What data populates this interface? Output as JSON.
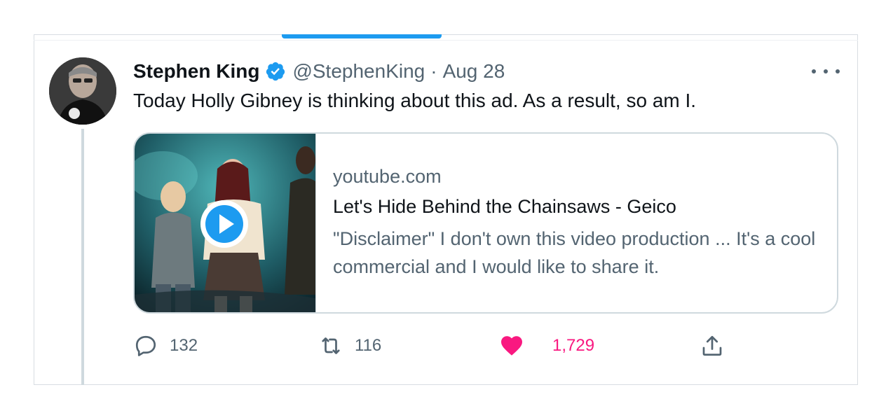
{
  "tweet": {
    "author_name": "Stephen King",
    "handle": "@StephenKing",
    "separator": "·",
    "date": "Aug 28",
    "text": "Today Holly Gibney is thinking about this ad. As a result, so am I."
  },
  "card": {
    "domain": "youtube.com",
    "title": "Let's Hide Behind the Chainsaws - Geico",
    "description": "\"Disclaimer\" I don't own this video production ... It's a cool commercial and I would like to share it."
  },
  "actions": {
    "replies": "132",
    "retweets": "116",
    "likes": "1,729"
  },
  "colors": {
    "accent": "#1d9bf0",
    "like": "#f91880",
    "secondary_text": "#536471"
  },
  "icons": {
    "verified": "verified-badge-icon",
    "more": "more-options-icon",
    "play": "play-icon",
    "reply": "reply-icon",
    "retweet": "retweet-icon",
    "like": "heart-icon",
    "share": "share-icon"
  }
}
